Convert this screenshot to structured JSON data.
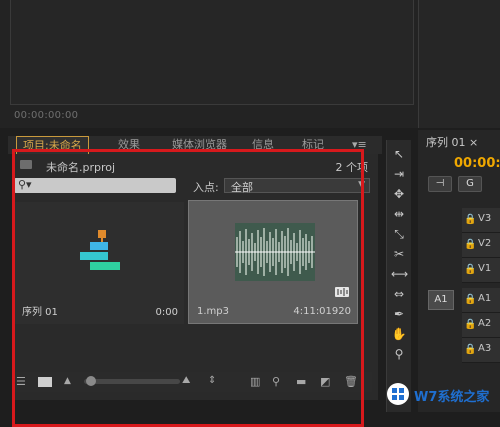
{
  "monitor": {
    "timecode": "00:00:00:00"
  },
  "tabs": [
    {
      "label": "项目:未命名",
      "active": true
    },
    {
      "label": "效果"
    },
    {
      "label": "媒体浏览器"
    },
    {
      "label": "信息"
    },
    {
      "label": "标记"
    }
  ],
  "project": {
    "name": "未命名.prproj",
    "item_count": "2 个项",
    "search_placeholder": "",
    "in_point_label": "入点:",
    "in_point_value": "全部"
  },
  "items": [
    {
      "name": "序列 01",
      "duration": "0:00",
      "type": "sequence"
    },
    {
      "name": "1.mp3",
      "duration": "4:11:01920",
      "type": "audio"
    }
  ],
  "toolbar_icons": [
    "list-view-icon",
    "icon-view-icon",
    "zoom-out-icon",
    "zoom-in-icon",
    "sort-icon",
    "automate-icon",
    "find-icon",
    "new-bin-icon",
    "new-item-icon",
    "delete-icon"
  ],
  "timeline": {
    "tab_label": "序列 01 ×",
    "timecode": "00:00:0",
    "video_tracks": [
      "V3",
      "V2",
      "V1"
    ],
    "source_track": "A1",
    "audio_tracks": [
      "A1",
      "A2",
      "A3"
    ]
  },
  "watermark": {
    "text": "W7系统之家"
  },
  "colors": {
    "accent": "#f0a800",
    "highlight": "#d7191c",
    "watermark": "#1f6fd0"
  }
}
